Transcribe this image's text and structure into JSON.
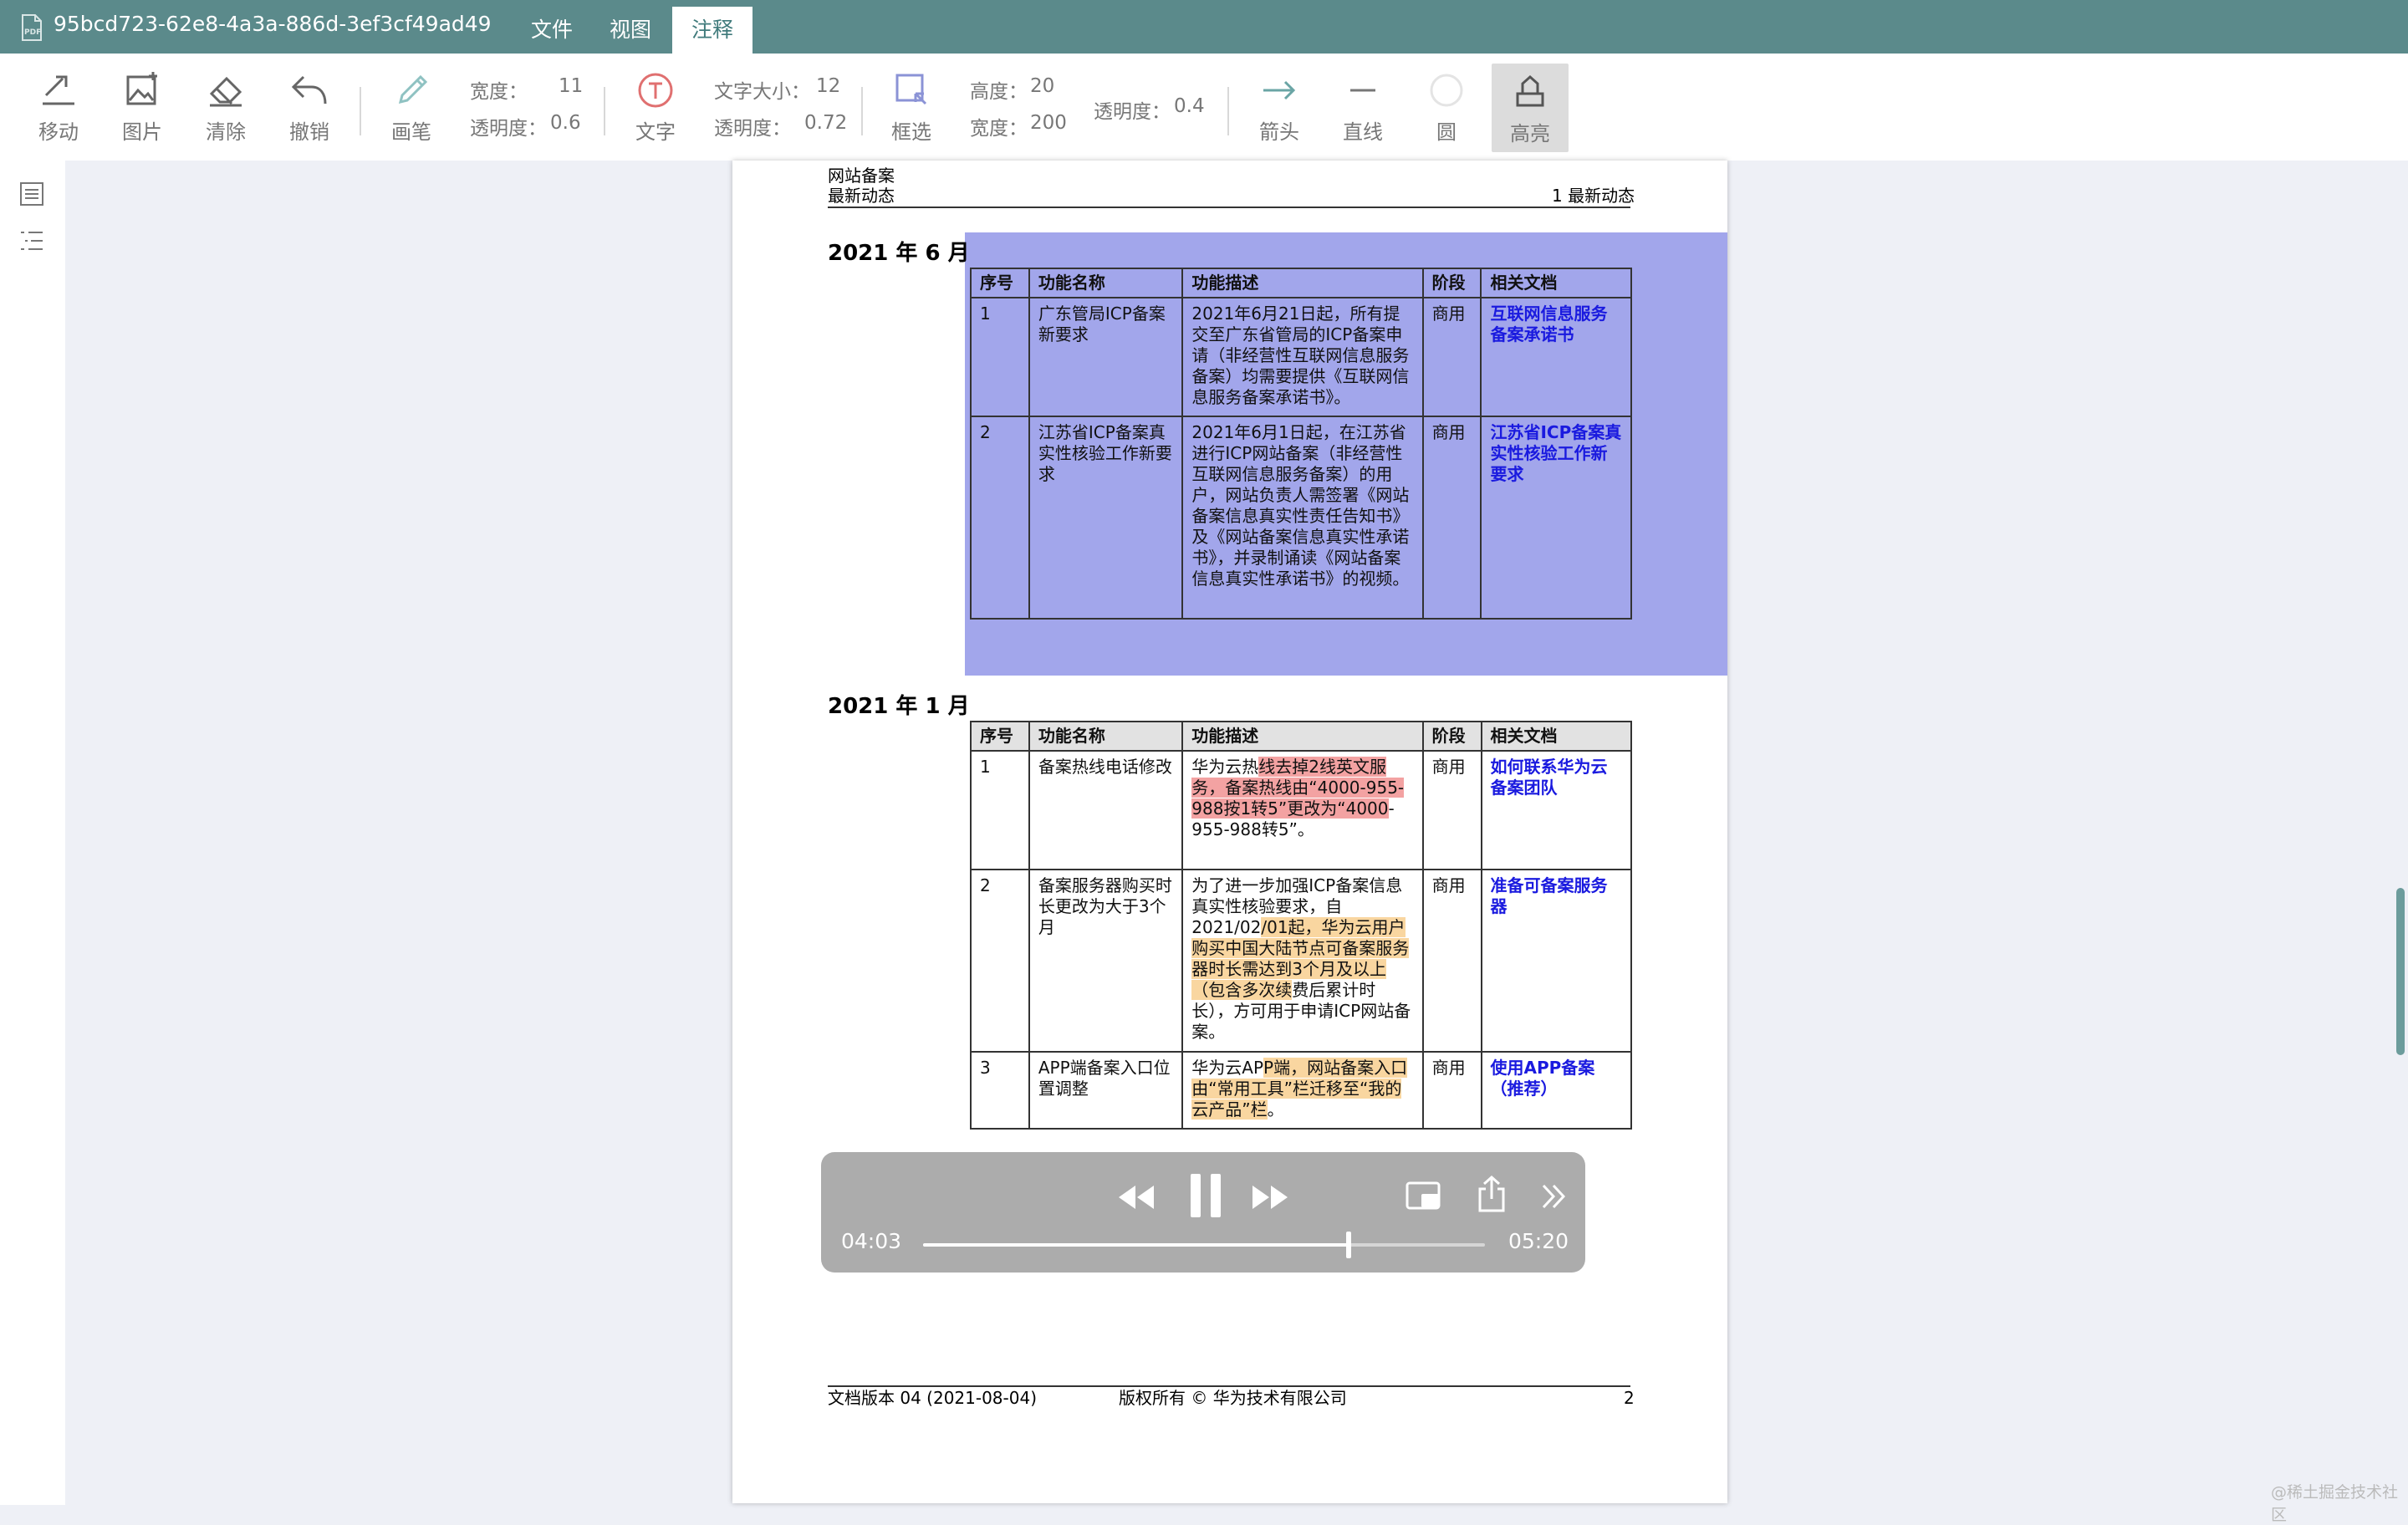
{
  "window": {
    "doc_title": "95bcd723-62e8-4a3a-886d-3ef3cf49ad49",
    "menus": [
      "文件",
      "视图",
      "注释"
    ],
    "active_menu": "注释",
    "accent_color": "#5b8a8b"
  },
  "toolbar": {
    "tools": {
      "move": "移动",
      "image": "图片",
      "clear": "清除",
      "undo": "撤销",
      "pen": "画笔",
      "text": "文字",
      "select": "框选",
      "arrow": "箭头",
      "line": "直线",
      "circle": "圆",
      "highlight": "高亮"
    },
    "active_tool": "高亮",
    "pen": {
      "width_label": "宽度：",
      "width_value": "11",
      "opacity_label": "透明度：",
      "opacity_value": "0.6"
    },
    "text": {
      "size_label": "文字大小：",
      "size_value": "12",
      "opacity_label": "透明度：",
      "opacity_value": "0.72"
    },
    "select": {
      "height_label": "高度：",
      "height_value": "20",
      "width_label": "宽度：",
      "width_value": "200"
    },
    "highlight": {
      "opacity_label": "透明度：",
      "opacity_value": "0.4"
    }
  },
  "sidebar": {
    "icons": [
      "thumbnail-icon",
      "outline-icon"
    ]
  },
  "page": {
    "header_line1": "网站备案",
    "header_line2": "最新动态",
    "header_right": "1 最新动态",
    "section1_title": "2021 年 6 月",
    "section2_title": "2021 年 1 月",
    "columns": [
      "序号",
      "功能名称",
      "功能描述",
      "阶段",
      "相关文档"
    ],
    "table1": [
      {
        "no": "1",
        "name": "广东管局ICP备案新要求",
        "desc": "2021年6月21日起，所有提交至广东省管局的ICP备案申请（非经营性互联网信息服务备案）均需要提供《互联网信息服务备案承诺书》。",
        "stage": "商用",
        "doc": "互联网信息服务备案承诺书"
      },
      {
        "no": "2",
        "name": "江苏省ICP备案真实性核验工作新要求",
        "desc": "2021年6月1日起，在江苏省进行ICP网站备案（非经营性互联网信息服务备案）的用户，网站负责人需签署《网站备案信息真实性责任告知书》及《网站备案信息真实性承诺书》，并录制诵读《网站备案信息真实性承诺书》的视频。",
        "stage": "商用",
        "doc": "江苏省ICP备案真实性核验工作新要求"
      }
    ],
    "table2": [
      {
        "no": "1",
        "name": "备案热线电话修改",
        "desc_parts": [
          "华为云热",
          "线去掉2线英文服务，备案热线由“4000-955-988按1转5”更改为“4000",
          "-955-988转5”。"
        ],
        "stage": "商用",
        "doc": "如何联系华为云备案团队"
      },
      {
        "no": "2",
        "name": "备案服务器购买时长更改为大于3个月",
        "desc_parts": [
          "为了进一步加强ICP备案信息真实性核验要求，自2021/02",
          "/01起，华为云用户购买中国大陆节点可备案服务器时长需达到3个月及以上（包含多次续",
          "费后累计时长），方可用于申请ICP网站备案。"
        ],
        "stage": "商用",
        "doc": "准备可备案服务器"
      },
      {
        "no": "3",
        "name": "APP端备案入口位置调整",
        "desc_parts": [
          "华为云AP",
          "P端，网站备案入口由“常用工具”栏迁移至“我的云产品”栏",
          "。"
        ],
        "stage": "商用",
        "doc": "使用APP备案（推荐）"
      }
    ],
    "footer_left": "文档版本 04 (2021-08-04)",
    "footer_center": "版权所有 © 华为技术有限公司",
    "footer_right": "2"
  },
  "player": {
    "current_time": "04:03",
    "total_time": "05:20",
    "progress": 0.757,
    "state": "playing"
  },
  "watermark": "@稀土掘金技术社区"
}
